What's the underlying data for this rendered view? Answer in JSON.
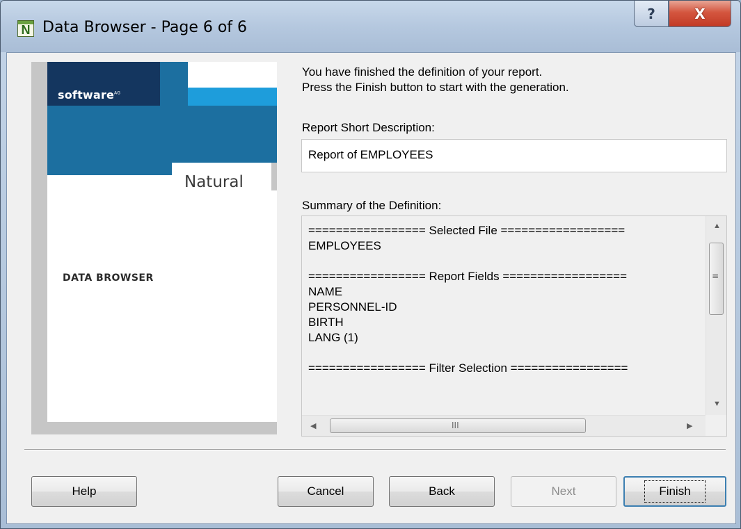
{
  "window": {
    "title": "Data Browser - Page 6 of 6",
    "app_icon_letter": "N",
    "help_button": "?",
    "close_button": "X"
  },
  "banner": {
    "logo": "software",
    "logo_suffix": "AG",
    "product": "Natural",
    "section": "DATA BROWSER"
  },
  "content": {
    "intro_line1": "You have finished the definition of your report.",
    "intro_line2": "Press the Finish button to start with the generation.",
    "short_desc_label": "Report Short Description:",
    "short_desc_value": "Report of EMPLOYEES",
    "summary_label": "Summary of the Definition:",
    "summary_lines": [
      "================= Selected File ==================",
      "EMPLOYEES",
      "",
      "================= Report Fields ==================",
      "NAME",
      "PERSONNEL-ID",
      "BIRTH",
      "LANG (1)",
      "",
      "================= Filter Selection ================="
    ]
  },
  "buttons": {
    "help": "Help",
    "cancel": "Cancel",
    "back": "Back",
    "next": "Next",
    "finish": "Finish"
  },
  "icons": {
    "scroll_up": "▲",
    "scroll_down": "▼",
    "scroll_left": "◀",
    "scroll_right": "▶",
    "grip_v": "≡",
    "grip_h": "III"
  }
}
